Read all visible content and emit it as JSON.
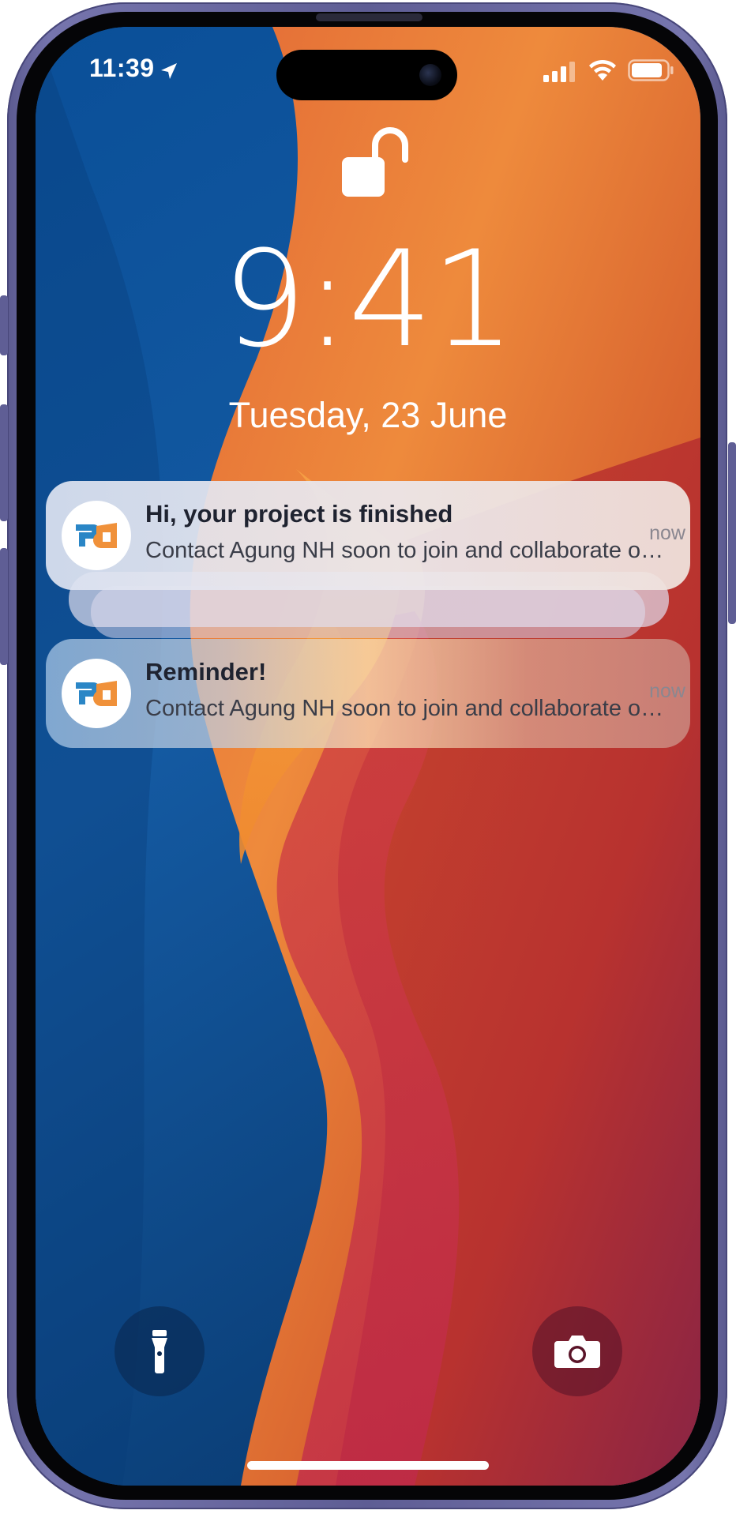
{
  "status_bar": {
    "time": "11:39",
    "location_icon": "location-arrow-icon",
    "signal_icon": "cellular-signal-icon",
    "wifi_icon": "wifi-icon",
    "battery_icon": "battery-icon"
  },
  "lock_screen": {
    "lock_icon": "unlocked-padlock-icon",
    "clock": "9:41",
    "date": "Tuesday,  23 June"
  },
  "notifications": [
    {
      "app_icon": "pd-app-logo",
      "title": "Hi, your project is finished",
      "body": "Contact Agung NH soon to join and collaborate on the project",
      "time": "now",
      "stacked": true
    },
    {
      "app_icon": "pd-app-logo",
      "title": "Reminder!",
      "body": "Contact Agung NH soon to join and collaborate on the project",
      "time": "now",
      "stacked": false
    }
  ],
  "quick_actions": {
    "left_icon": "flashlight-icon",
    "right_icon": "camera-icon"
  },
  "colors": {
    "wallpaper_blue": "#1c5aa8",
    "wallpaper_orange": "#e8823a",
    "wallpaper_red": "#c6373d",
    "frame_purple": "#6a69a3",
    "logo_blue": "#2a86c6",
    "logo_orange": "#f0913a"
  }
}
